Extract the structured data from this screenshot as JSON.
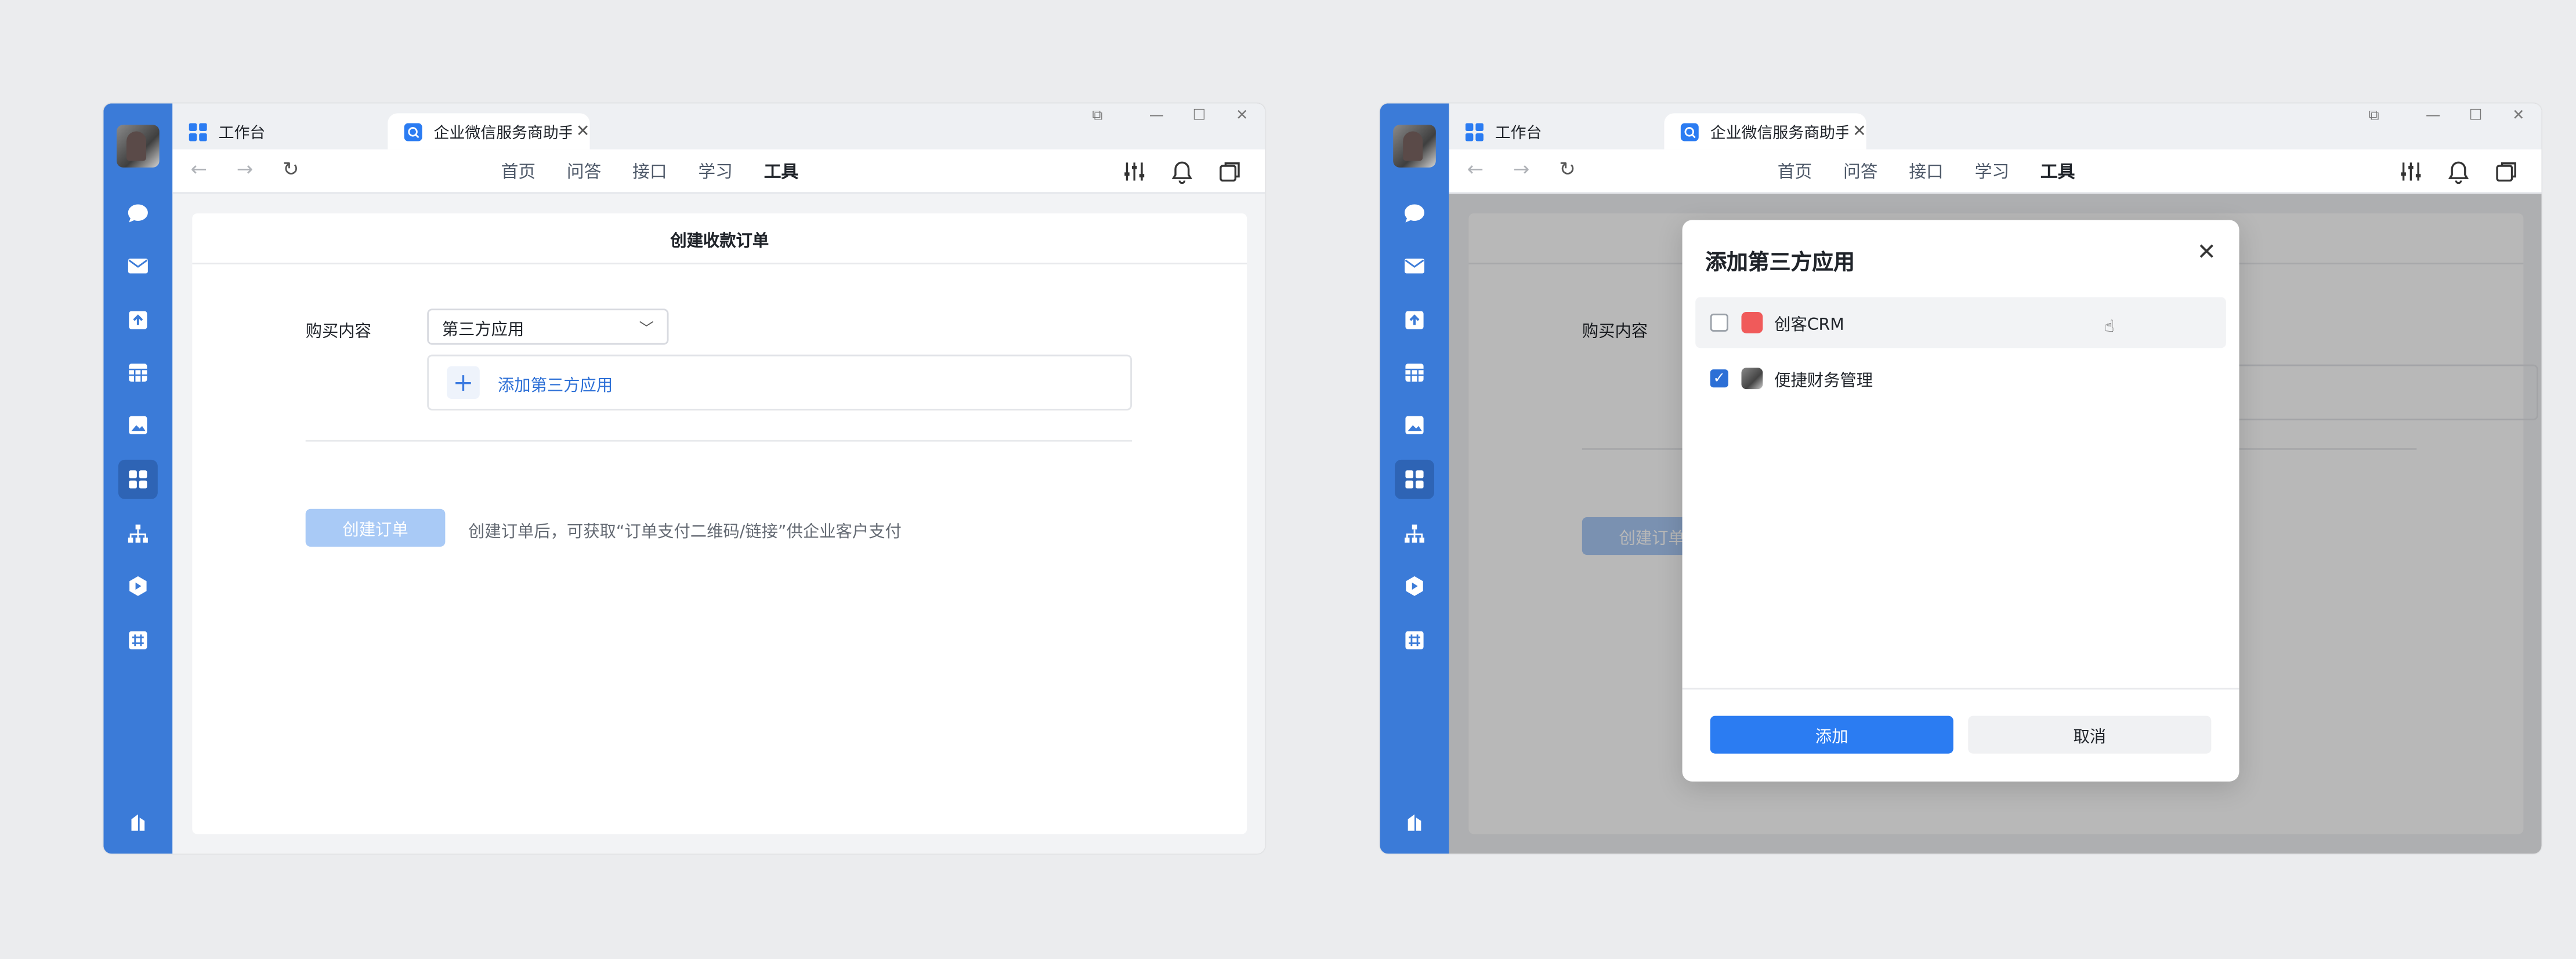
{
  "colors": {
    "rail": "#3b7bd8",
    "primary": "#2b7cf2",
    "disabled_primary": "#a9caf6",
    "link": "#2c6fd6",
    "crm_icon": "#f05a5a"
  },
  "tabs": {
    "workbench": "工作台",
    "service": "企业微信服务商助手能"
  },
  "nav": {
    "items": [
      "首页",
      "问答",
      "接口",
      "学习",
      "工具"
    ],
    "active": "工具",
    "back_icon": "arrow-left-icon",
    "forward_icon": "arrow-right-icon",
    "refresh_icon": "refresh-icon"
  },
  "rail_icons": [
    "chat-icon",
    "mail-icon",
    "docs-icon",
    "calendar-icon",
    "photo-icon",
    "workbench-icon",
    "org-icon",
    "app-icon",
    "grid-icon",
    "building-icon"
  ],
  "page": {
    "title": "创建收款订单",
    "field_label": "购买内容",
    "select_value": "第三方应用",
    "add_link": "添加第三方应用",
    "create_button": "创建订单",
    "hint": "创建订单后，可获取“订单支付二维码/链接”供企业客户支付"
  },
  "modal": {
    "title": "添加第三方应用",
    "items": [
      {
        "name": "创客CRM",
        "checked": false
      },
      {
        "name": "便捷财务管理",
        "checked": true
      }
    ],
    "add_button": "添加",
    "cancel_button": "取消"
  }
}
